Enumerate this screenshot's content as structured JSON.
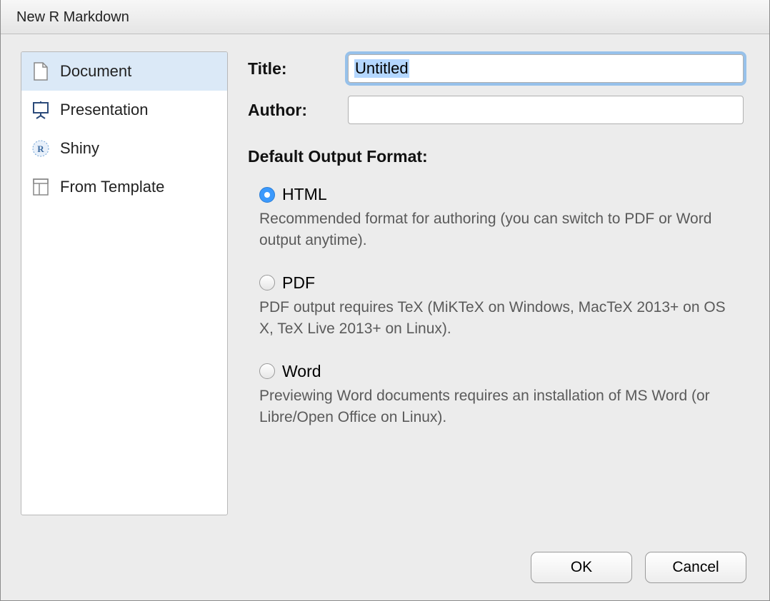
{
  "dialog": {
    "title": "New R Markdown"
  },
  "sidebar": {
    "items": [
      {
        "label": "Document",
        "icon": "document-icon",
        "selected": true
      },
      {
        "label": "Presentation",
        "icon": "presentation-icon",
        "selected": false
      },
      {
        "label": "Shiny",
        "icon": "shiny-icon",
        "selected": false
      },
      {
        "label": "From Template",
        "icon": "template-icon",
        "selected": false
      }
    ]
  },
  "fields": {
    "title": {
      "label": "Title:",
      "value": "Untitled"
    },
    "author": {
      "label": "Author:",
      "value": ""
    }
  },
  "format": {
    "heading": "Default Output Format:",
    "options": [
      {
        "label": "HTML",
        "selected": true,
        "desc": "Recommended format for authoring (you can switch to PDF or Word output anytime)."
      },
      {
        "label": "PDF",
        "selected": false,
        "desc": "PDF output requires TeX (MiKTeX on Windows, MacTeX 2013+ on OS X, TeX Live 2013+ on Linux)."
      },
      {
        "label": "Word",
        "selected": false,
        "desc": "Previewing Word documents requires an installation of MS Word (or Libre/Open Office on Linux)."
      }
    ]
  },
  "buttons": {
    "ok": "OK",
    "cancel": "Cancel"
  }
}
